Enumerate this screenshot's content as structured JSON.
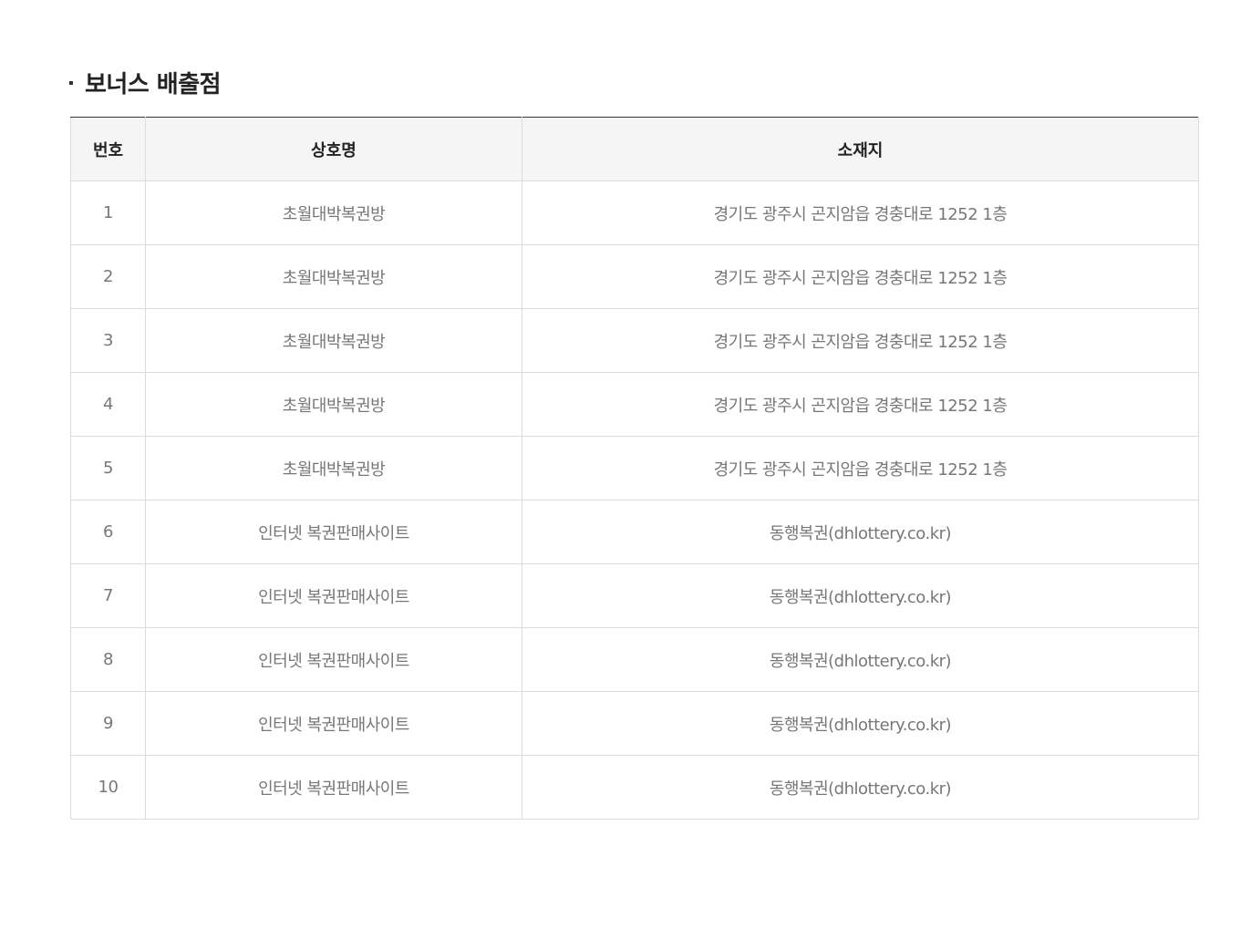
{
  "section": {
    "title": "보너스 배출점"
  },
  "table": {
    "headers": [
      "번호",
      "상호명",
      "소재지"
    ],
    "rows": [
      {
        "no": "1",
        "name": "초월대박복권방",
        "address": "경기도 광주시 곤지암읍 경충대로 1252 1층"
      },
      {
        "no": "2",
        "name": "초월대박복권방",
        "address": "경기도 광주시 곤지암읍 경충대로 1252 1층"
      },
      {
        "no": "3",
        "name": "초월대박복권방",
        "address": "경기도 광주시 곤지암읍 경충대로 1252 1층"
      },
      {
        "no": "4",
        "name": "초월대박복권방",
        "address": "경기도 광주시 곤지암읍 경충대로 1252 1층"
      },
      {
        "no": "5",
        "name": "초월대박복권방",
        "address": "경기도 광주시 곤지암읍 경충대로 1252 1층"
      },
      {
        "no": "6",
        "name": "인터넷 복권판매사이트",
        "address": "동행복권(dhlottery.co.kr)"
      },
      {
        "no": "7",
        "name": "인터넷 복권판매사이트",
        "address": "동행복권(dhlottery.co.kr)"
      },
      {
        "no": "8",
        "name": "인터넷 복권판매사이트",
        "address": "동행복권(dhlottery.co.kr)"
      },
      {
        "no": "9",
        "name": "인터넷 복권판매사이트",
        "address": "동행복권(dhlottery.co.kr)"
      },
      {
        "no": "10",
        "name": "인터넷 복권판매사이트",
        "address": "동행복권(dhlottery.co.kr)"
      }
    ]
  },
  "colors": {
    "header_bg": "#f5f5f5",
    "header_text": "#222222",
    "cell_text": "#777777",
    "border": "#dcdcdc",
    "top_border": "#333333"
  }
}
